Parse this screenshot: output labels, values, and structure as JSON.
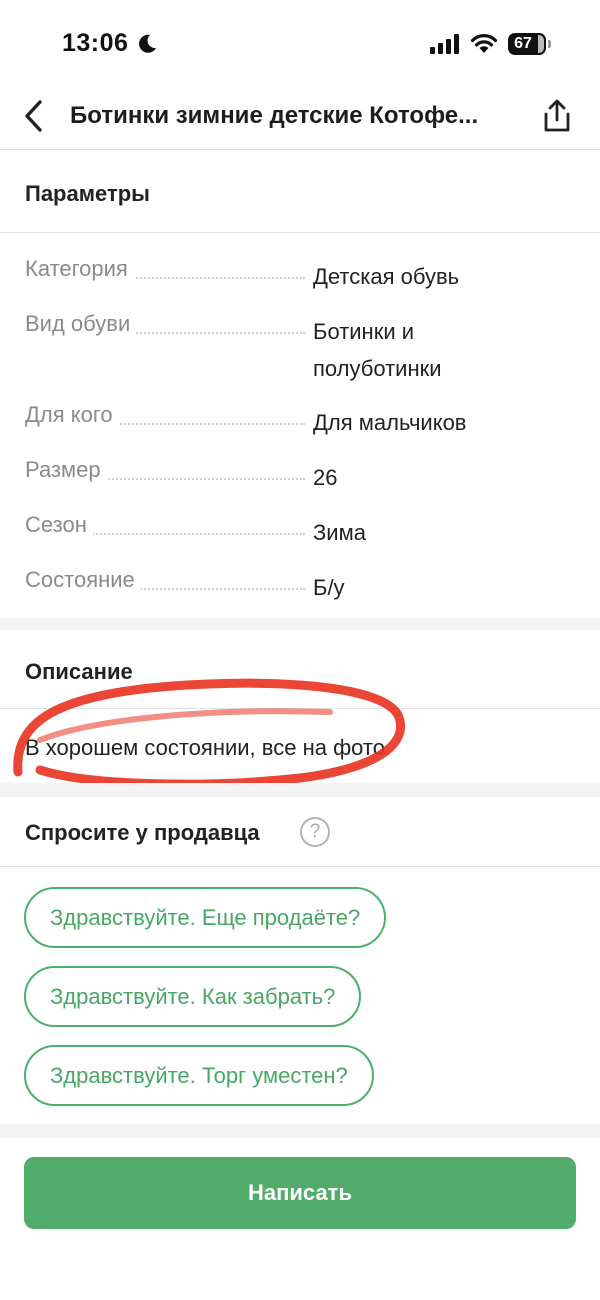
{
  "status_bar": {
    "time": "13:06",
    "battery": "67",
    "icons": [
      "moon-icon",
      "signal-icon",
      "wifi-icon",
      "battery-icon"
    ]
  },
  "nav": {
    "title": "Ботинки зимние детские Котофе...",
    "icons": [
      "back-chevron-icon",
      "share-icon"
    ]
  },
  "params": {
    "title": "Параметры",
    "rows": [
      {
        "label": "Категория",
        "value": "Детская обувь"
      },
      {
        "label": "Вид обуви",
        "value": "Ботинки и полуботинки"
      },
      {
        "label": "Для кого",
        "value": "Для мальчиков"
      },
      {
        "label": "Размер",
        "value": "26"
      },
      {
        "label": "Сезон",
        "value": "Зима"
      },
      {
        "label": "Состояние",
        "value": "Б/у"
      }
    ]
  },
  "description": {
    "title": "Описание",
    "text": "В хорошем состоянии, все на фото",
    "annotation_color": "#e8311f"
  },
  "ask_seller": {
    "title": "Спросите у продавца",
    "help_symbol": "?",
    "chips": [
      "Здравствуйте. Еще продаёте?",
      "Здравствуйте. Как забрать?",
      "Здравствуйте. Торг уместен?"
    ]
  },
  "action": {
    "write_label": "Написать"
  },
  "colors": {
    "accent": "#51ac6b",
    "chip_text": "#48a765",
    "label_gray": "#8a8a8a"
  }
}
